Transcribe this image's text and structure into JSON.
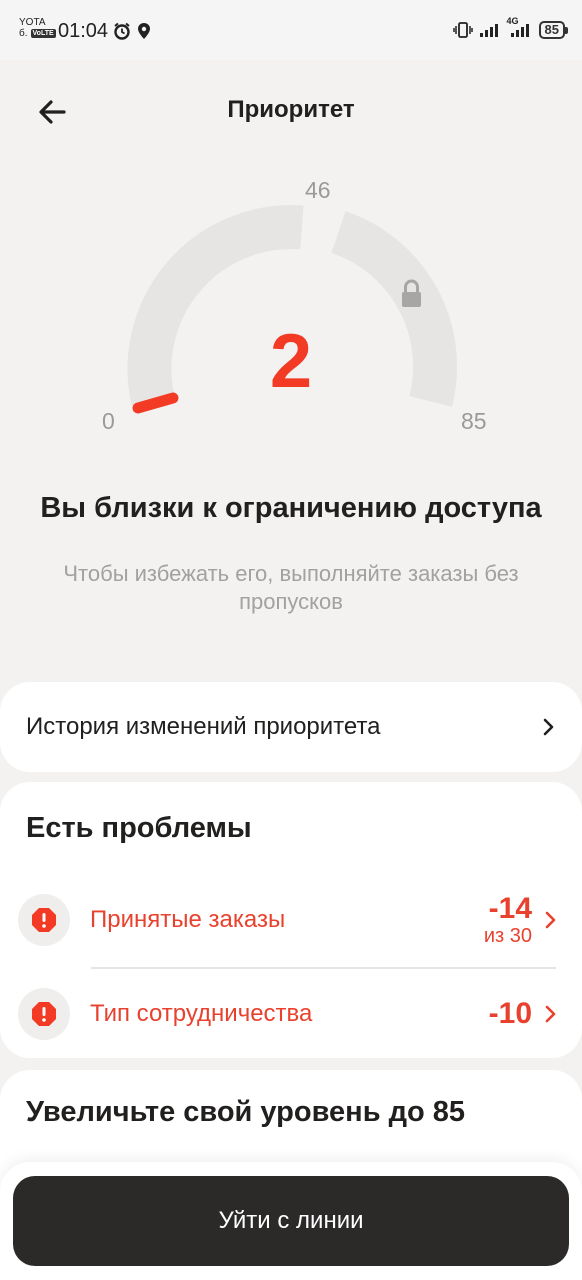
{
  "status_bar": {
    "carrier": "YOTA",
    "sim": "б.",
    "volte": "VoLTE",
    "time": "01:04",
    "network": "4G",
    "battery": "85"
  },
  "header": {
    "title": "Приоритет"
  },
  "gauge": {
    "value": "2",
    "min_label": "0",
    "mid_label": "46",
    "max_label": "85",
    "value_number": 2,
    "min": 0,
    "max": 85,
    "locked_from": 46,
    "accent_color": "#f23a25",
    "track_color": "#e6e5e3"
  },
  "message": {
    "headline": "Вы близки к ограничению доступа",
    "subline": "Чтобы избежать его, выполняйте заказы без пропусков"
  },
  "history": {
    "label": "История изменений приоритета"
  },
  "problems": {
    "title": "Есть проблемы",
    "items": [
      {
        "label": "Принятые заказы",
        "value": "-14",
        "sub": "из 30",
        "icon": "alert-icon"
      },
      {
        "label": "Тип сотрудничества",
        "value": "-10",
        "sub": "",
        "icon": "alert-icon"
      }
    ]
  },
  "level": {
    "title": "Увеличьте свой уровень до 85"
  },
  "bottom": {
    "button_label": "Уйти с линии"
  }
}
